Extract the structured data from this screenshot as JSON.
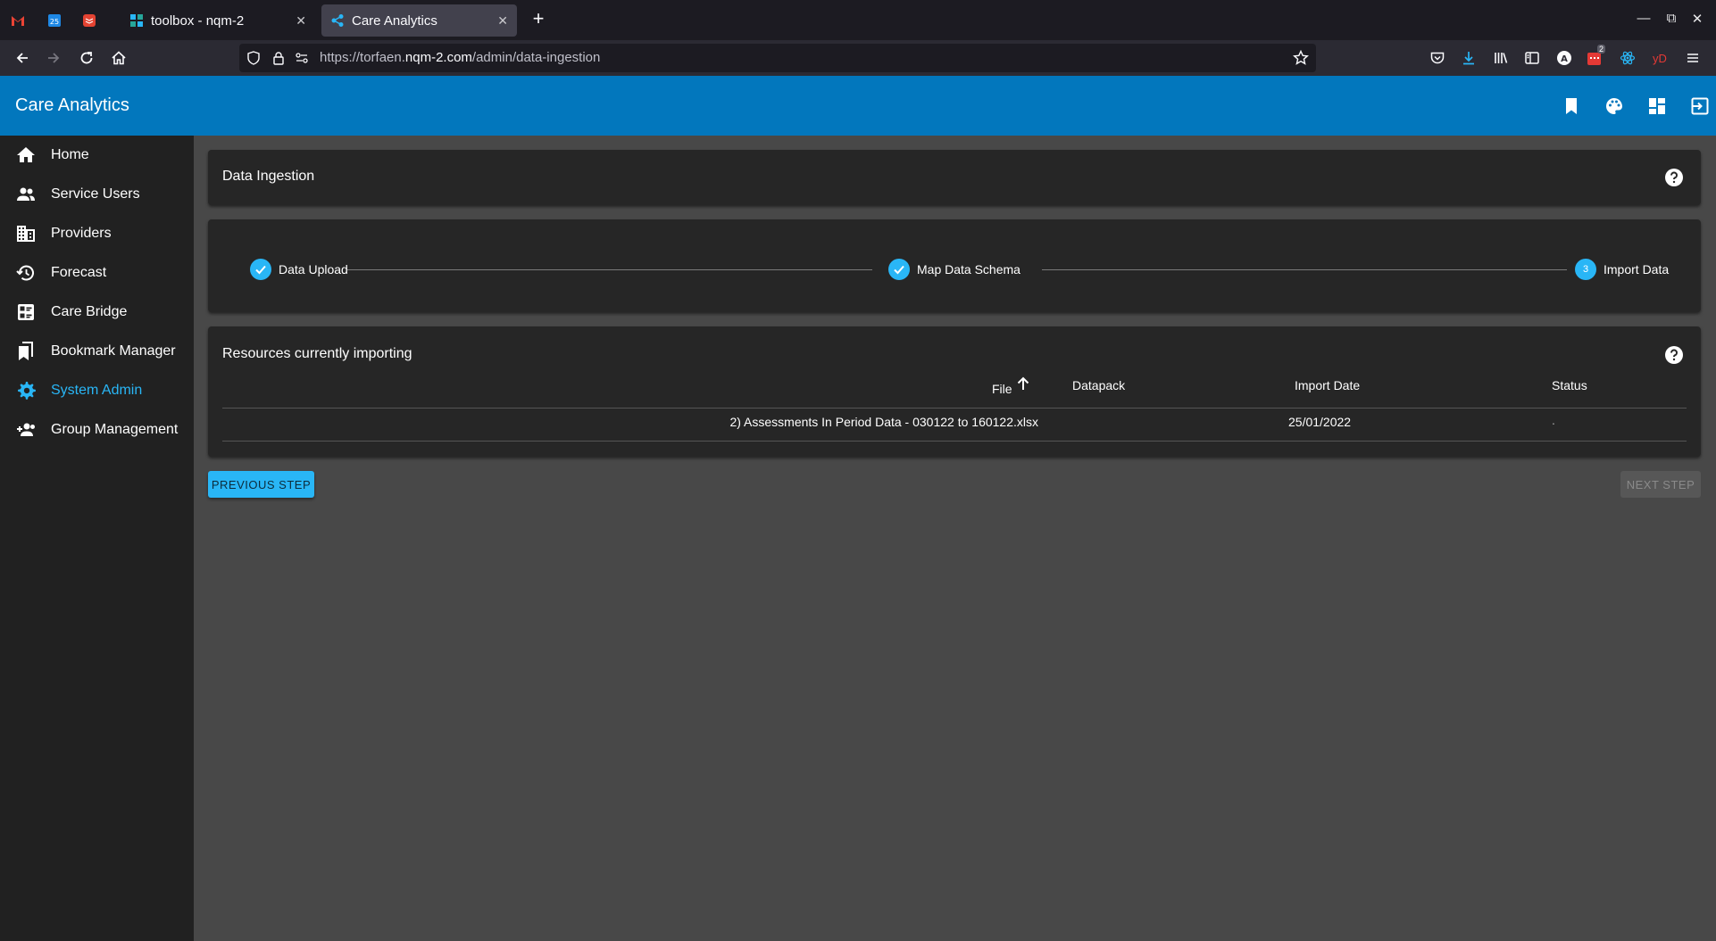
{
  "browser": {
    "tabs": [
      {
        "title": "toolbox - nqm-2",
        "close": "✕"
      },
      {
        "title": "Care Analytics",
        "close": "✕"
      }
    ],
    "new_tab": "+",
    "url_prefix": "https://torfaen.",
    "url_domain": "nqm-2.com",
    "url_path": "/admin/data-ingestion",
    "badge_count": "2",
    "ext_label": "yD"
  },
  "app": {
    "title": "Care Analytics",
    "accent": "#0277bd",
    "highlight": "#29b6f6"
  },
  "sidebar": {
    "items": [
      {
        "label": "Home",
        "icon": "home-icon"
      },
      {
        "label": "Service Users",
        "icon": "people-icon"
      },
      {
        "label": "Providers",
        "icon": "building-icon"
      },
      {
        "label": "Forecast",
        "icon": "history-icon"
      },
      {
        "label": "Care Bridge",
        "icon": "dashboard-list-icon"
      },
      {
        "label": "Bookmark Manager",
        "icon": "bookmarks-icon"
      },
      {
        "label": "System Admin",
        "icon": "gear-icon"
      },
      {
        "label": "Group Management",
        "icon": "group-add-icon"
      }
    ],
    "active": "System Admin"
  },
  "main": {
    "page_title": "Data Ingestion",
    "stepper": {
      "steps": [
        {
          "label": "Data Upload",
          "state": "complete"
        },
        {
          "label": "Map Data Schema",
          "state": "complete"
        },
        {
          "label": "Import Data",
          "state": "active",
          "number": "3"
        }
      ]
    },
    "resources": {
      "title": "Resources currently importing",
      "columns": [
        "File",
        "Datapack",
        "Import Date",
        "Status"
      ],
      "rows": [
        {
          "file": "2) Assessments In Period Data - 030122 to 160122.xlsx",
          "datapack": "",
          "import_date": "25/01/2022",
          "status": "."
        }
      ]
    },
    "buttons": {
      "previous": "PREVIOUS STEP",
      "next": "NEXT STEP"
    }
  }
}
